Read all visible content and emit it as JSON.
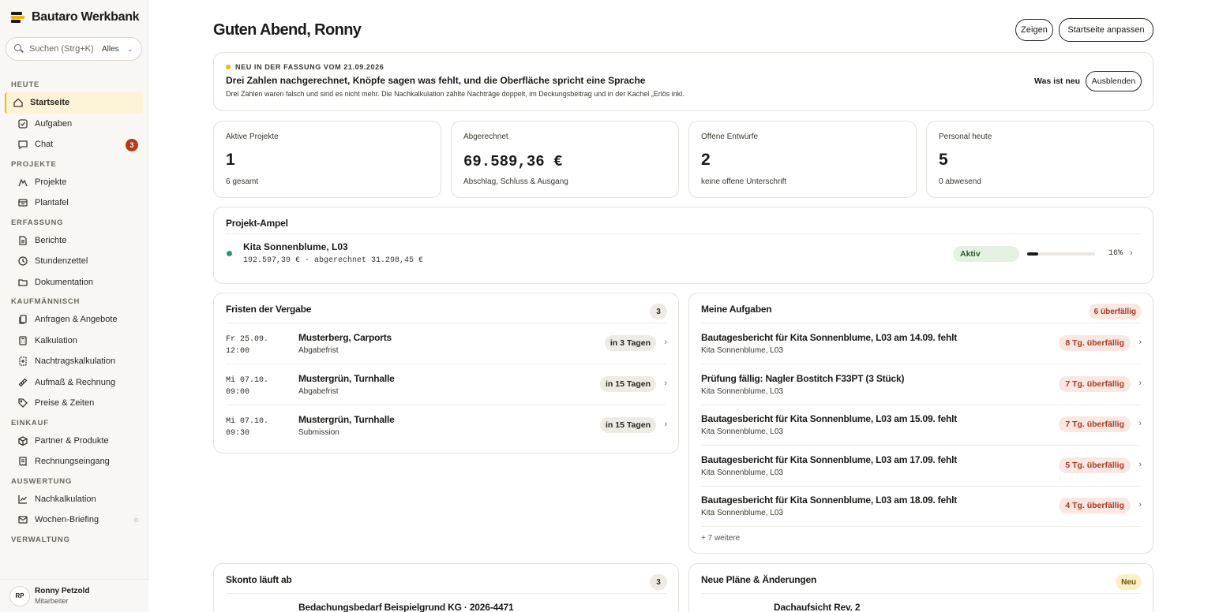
{
  "app": {
    "title": "Bautaro Werkbank"
  },
  "search": {
    "placeholder": "Suchen (Strg+K)",
    "value": "",
    "scope": "Alles"
  },
  "sidebar": {
    "sections": [
      {
        "label": "HEUTE",
        "items": [
          {
            "label": "Startseite",
            "icon": "home-icon",
            "active": true
          },
          {
            "label": "Aufgaben",
            "icon": "check-square-icon"
          },
          {
            "label": "Chat",
            "icon": "chat-icon",
            "badge": "3"
          }
        ]
      },
      {
        "label": "PROJEKTE",
        "items": [
          {
            "label": "Projekte",
            "icon": "crane-icon"
          },
          {
            "label": "Plantafel",
            "icon": "board-icon"
          }
        ]
      },
      {
        "label": "ERFASSUNG",
        "items": [
          {
            "label": "Berichte",
            "icon": "document-icon"
          },
          {
            "label": "Stundenzettel",
            "icon": "clock-icon"
          },
          {
            "label": "Dokumentation",
            "icon": "folder-icon"
          }
        ]
      },
      {
        "label": "KAUFMÄNNISCH",
        "items": [
          {
            "label": "Anfragen & Angebote",
            "icon": "copy-icon"
          },
          {
            "label": "Kalkulation",
            "icon": "calculator-icon"
          },
          {
            "label": "Nachtragskalkulation",
            "icon": "calculator-plus-icon"
          },
          {
            "label": "Aufmaß & Rechnung",
            "icon": "ruler-icon"
          },
          {
            "label": "Preise & Zeiten",
            "icon": "tag-icon"
          }
        ]
      },
      {
        "label": "EINKAUF",
        "items": [
          {
            "label": "Partner & Produkte",
            "icon": "box-icon"
          },
          {
            "label": "Rechnungseingang",
            "icon": "receipt-icon"
          }
        ]
      },
      {
        "label": "AUSWERTUNG",
        "items": [
          {
            "label": "Nachkalkulation",
            "icon": "chart-line-icon"
          },
          {
            "label": "Wochen-Briefing",
            "icon": "mail-icon",
            "dot": true
          }
        ]
      },
      {
        "label": "VERWALTUNG",
        "items": []
      }
    ]
  },
  "user": {
    "initials": "RP",
    "name": "Ronny Petzold",
    "role": "Mitarbeiter"
  },
  "header": {
    "greeting": "Guten Abend, Ronny",
    "show_label": "Zeigen",
    "customize_label": "Startseite anpassen"
  },
  "news": {
    "tag": "NEU IN DER FASSUNG VOM 21.09.2026",
    "title": "Drei Zahlen nachgerechnet, Knöpfe sagen was fehlt, und die Oberfläche spricht eine Sprache",
    "body": "Drei Zahlen waren falsch und sind es nicht mehr. Die Nachkalkulation zählte Nachträge doppelt, im Deckungsbeitrag und in der Kachel „Erlös inkl.",
    "link": "Was ist neu",
    "hide_label": "Ausblenden"
  },
  "kpis": [
    {
      "label": "Aktive Projekte",
      "value": "1",
      "sub": "6 gesamt",
      "mono": false
    },
    {
      "label": "Abgerechnet",
      "value": "69.589,36 €",
      "sub": "Abschlag, Schluss & Ausgang",
      "mono": true
    },
    {
      "label": "Offene Entwürfe",
      "value": "2",
      "sub": "keine offene Unterschrift",
      "mono": false
    },
    {
      "label": "Personal heute",
      "value": "5",
      "sub": "0 abwesend",
      "mono": false
    }
  ],
  "ampel": {
    "title": "Projekt-Ampel",
    "project": {
      "name": "Kita Sonnenblume, L03",
      "sub": "192.597,39 € · abgerechnet 31.298,45 €",
      "status": "Aktiv",
      "progress": 16,
      "progress_label": "16%",
      "status_color": "#1f9a83"
    }
  },
  "fristen": {
    "title": "Fristen der Vergabe",
    "count": "3",
    "rows": [
      {
        "date": "Fr 25.09.",
        "time": "12:00",
        "name": "Musterberg, Carports",
        "sub": "Abgabefrist",
        "due": "in 3 Tagen"
      },
      {
        "date": "Mi 07.10.",
        "time": "09:00",
        "name": "Mustergrün, Turnhalle",
        "sub": "Abgabefrist",
        "due": "in 15 Tagen"
      },
      {
        "date": "Mi 07.10.",
        "time": "09:30",
        "name": "Mustergrün, Turnhalle",
        "sub": "Submission",
        "due": "in 15 Tagen"
      }
    ]
  },
  "aufgaben": {
    "title": "Meine Aufgaben",
    "badge": "6 überfällig",
    "rows": [
      {
        "title": "Bautagesbericht für Kita Sonnenblume, L03 am 14.09. fehlt",
        "sub": "Kita Sonnenblume, L03",
        "overdue": "8 Tg. überfällig"
      },
      {
        "title": "Prüfung fällig: Nagler Bostitch F33PT (3 Stück)",
        "sub": "Kita Sonnenblume, L03",
        "overdue": "7 Tg. überfällig"
      },
      {
        "title": "Bautagesbericht für Kita Sonnenblume, L03 am 15.09. fehlt",
        "sub": "Kita Sonnenblume, L03",
        "overdue": "7 Tg. überfällig"
      },
      {
        "title": "Bautagesbericht für Kita Sonnenblume, L03 am 17.09. fehlt",
        "sub": "Kita Sonnenblume, L03",
        "overdue": "5 Tg. überfällig"
      },
      {
        "title": "Bautagesbericht für Kita Sonnenblume, L03 am 18.09. fehlt",
        "sub": "Kita Sonnenblume, L03",
        "overdue": "4 Tg. überfällig"
      }
    ],
    "more": "+ 7 weitere"
  },
  "skonto": {
    "title": "Skonto läuft ab",
    "count": "3",
    "first_row": "Bedachungsbedarf Beispielgrund KG · 2026-4471"
  },
  "plaene": {
    "title": "Neue Pläne & Änderungen",
    "badge": "Neu",
    "first_row": "Dachaufsicht Rev. 2"
  },
  "colors": {
    "accent": "#f2b705",
    "danger": "#b53a1e",
    "ok": "#1f9a83"
  }
}
